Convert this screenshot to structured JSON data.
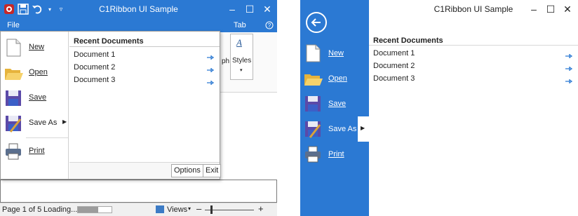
{
  "left_window": {
    "title": "C1Ribbon UI Sample",
    "file_tab": "File",
    "tabs": [
      "Tab"
    ],
    "help_icon": "help-circle-icon",
    "ribbon_visible": {
      "partial_label": "ph",
      "styles_label": "Styles"
    },
    "menu": {
      "items": [
        {
          "id": "new",
          "label": "New",
          "icon": "new-document-icon"
        },
        {
          "id": "open",
          "label": "Open",
          "icon": "folder-open-icon"
        },
        {
          "id": "save",
          "label": "Save",
          "icon": "floppy-disk-icon"
        },
        {
          "id": "saveas",
          "label": "Save As",
          "icon": "save-as-icon"
        },
        {
          "id": "print",
          "label": "Print",
          "icon": "printer-icon"
        }
      ],
      "recent_header": "Recent Documents",
      "recent": [
        "Document 1",
        "Document 2",
        "Document 3"
      ],
      "options_label": "Options",
      "exit_label": "Exit"
    },
    "status": {
      "page": "Page 1 of 5",
      "loading": "Loading...",
      "views_label": "Views"
    }
  },
  "right_window": {
    "title": "C1Ribbon UI Sample",
    "items": [
      {
        "id": "new",
        "label": "New",
        "icon": "new-document-icon"
      },
      {
        "id": "open",
        "label": "Open",
        "icon": "folder-open-icon"
      },
      {
        "id": "save",
        "label": "Save",
        "icon": "floppy-disk-icon"
      },
      {
        "id": "saveas",
        "label": "Save As",
        "icon": "save-as-icon"
      },
      {
        "id": "print",
        "label": "Print",
        "icon": "printer-icon"
      }
    ],
    "recent_header": "Recent Documents",
    "recent": [
      "Document 1",
      "Document 2",
      "Document 3"
    ]
  },
  "colors": {
    "accent": "#2b79d3",
    "pin": "#2b79d3"
  }
}
